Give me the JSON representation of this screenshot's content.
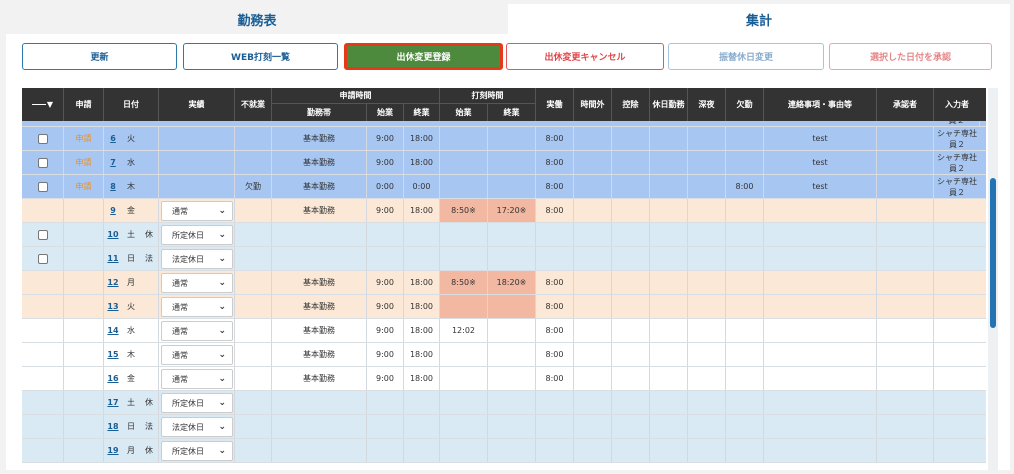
{
  "tabs": [
    {
      "label": "勤務表"
    },
    {
      "label": "集計"
    }
  ],
  "toolbar": {
    "update": "更新",
    "web_list": "WEB打刻一覧",
    "leave_change_register": "出休変更登録",
    "leave_change_cancel": "出休変更キャンセル",
    "substitute_change": "振替休日変更",
    "approve_selected": "選択した日付を承認"
  },
  "table": {
    "headers": {
      "check": "▼",
      "request": "申請",
      "date": "日付",
      "actual": "実績",
      "absence": "不就業",
      "request_time": "申請時間",
      "shift": "勤務帯",
      "start": "始業",
      "end": "終業",
      "stamp_time": "打刻時間",
      "stamp_start": "始業",
      "stamp_end": "終業",
      "worked": "実働",
      "overtime": "時間外",
      "deduction": "控除",
      "holiday_work": "休日勤務",
      "late_night": "深夜",
      "absent": "欠勤",
      "notes": "連絡事項・事由等",
      "approver": "承認者",
      "entered_by": "入力者"
    },
    "partial_top": "員２",
    "rows": [
      {
        "bg": "#a7c6f2",
        "check": true,
        "req": "申請",
        "day": "6",
        "wd": "火",
        "hol": "",
        "actual": "",
        "absence": "",
        "shift": "基本勤務",
        "start": "9:00",
        "end": "18:00",
        "s_start": "",
        "s_end": "",
        "worked": "8:00",
        "absent": "",
        "notes": "test",
        "entered_line1": "シャチ専社",
        "entered_line2": "員２"
      },
      {
        "bg": "#a7c6f2",
        "check": true,
        "req": "申請",
        "day": "7",
        "wd": "水",
        "hol": "",
        "actual": "",
        "absence": "",
        "shift": "基本勤務",
        "start": "9:00",
        "end": "18:00",
        "s_start": "",
        "s_end": "",
        "worked": "8:00",
        "absent": "",
        "notes": "test",
        "entered_line1": "シャチ専社",
        "entered_line2": "員２"
      },
      {
        "bg": "#a7c6f2",
        "check": true,
        "req": "申請",
        "day": "8",
        "wd": "木",
        "hol": "",
        "actual": "",
        "absence": "欠勤",
        "shift": "基本勤務",
        "start": "0:00",
        "end": "0:00",
        "s_start": "",
        "s_end": "",
        "worked": "8:00",
        "absent": "8:00",
        "notes": "test",
        "entered_line1": "シャチ専社",
        "entered_line2": "員２"
      },
      {
        "bg": "#fbe8d6",
        "check": false,
        "req": "",
        "day": "9",
        "wd": "金",
        "hol": "",
        "actual": "通常",
        "absence": "",
        "shift": "基本勤務",
        "start": "9:00",
        "end": "18:00",
        "s_start": "8:50※",
        "s_end": "17:20※",
        "pink": true,
        "worked": "8:00",
        "absent": "",
        "notes": "",
        "entered_line1": "",
        "entered_line2": ""
      },
      {
        "bg": "#d9eaf4",
        "check": true,
        "req": "",
        "day": "10",
        "wd": "土",
        "hol": "休",
        "actual": "所定休日",
        "absence": "",
        "shift": "",
        "start": "",
        "end": "",
        "s_start": "",
        "s_end": "",
        "worked": "",
        "absent": "",
        "notes": "",
        "entered_line1": "",
        "entered_line2": ""
      },
      {
        "bg": "#d9eaf4",
        "check": true,
        "req": "",
        "day": "11",
        "wd": "日",
        "hol": "法",
        "actual": "法定休日",
        "absence": "",
        "shift": "",
        "start": "",
        "end": "",
        "s_start": "",
        "s_end": "",
        "worked": "",
        "absent": "",
        "notes": "",
        "entered_line1": "",
        "entered_line2": ""
      },
      {
        "bg": "#fbe8d6",
        "check": false,
        "req": "",
        "day": "12",
        "wd": "月",
        "hol": "",
        "actual": "通常",
        "absence": "",
        "shift": "基本勤務",
        "start": "9:00",
        "end": "18:00",
        "s_start": "8:50※",
        "s_end": "18:20※",
        "pink": true,
        "worked": "8:00",
        "absent": "",
        "notes": "",
        "entered_line1": "",
        "entered_line2": ""
      },
      {
        "bg": "#fbe8d6",
        "check": false,
        "req": "",
        "day": "13",
        "wd": "火",
        "hol": "",
        "actual": "通常",
        "absence": "",
        "shift": "基本勤務",
        "start": "9:00",
        "end": "18:00",
        "s_start": "",
        "s_end": "",
        "pink": true,
        "worked": "8:00",
        "absent": "",
        "notes": "",
        "entered_line1": "",
        "entered_line2": ""
      },
      {
        "bg": "#ffffff",
        "check": false,
        "req": "",
        "day": "14",
        "wd": "水",
        "hol": "",
        "actual": "通常",
        "absence": "",
        "shift": "基本勤務",
        "start": "9:00",
        "end": "18:00",
        "s_start": "12:02",
        "s_end": "",
        "worked": "8:00",
        "absent": "",
        "notes": "",
        "entered_line1": "",
        "entered_line2": ""
      },
      {
        "bg": "#ffffff",
        "check": false,
        "req": "",
        "day": "15",
        "wd": "木",
        "hol": "",
        "actual": "通常",
        "absence": "",
        "shift": "基本勤務",
        "start": "9:00",
        "end": "18:00",
        "s_start": "",
        "s_end": "",
        "worked": "8:00",
        "absent": "",
        "notes": "",
        "entered_line1": "",
        "entered_line2": ""
      },
      {
        "bg": "#ffffff",
        "check": false,
        "req": "",
        "day": "16",
        "wd": "金",
        "hol": "",
        "actual": "通常",
        "absence": "",
        "shift": "基本勤務",
        "start": "9:00",
        "end": "18:00",
        "s_start": "",
        "s_end": "",
        "worked": "8:00",
        "absent": "",
        "notes": "",
        "entered_line1": "",
        "entered_line2": ""
      },
      {
        "bg": "#d9eaf4",
        "check": false,
        "req": "",
        "day": "17",
        "wd": "土",
        "hol": "休",
        "actual": "所定休日",
        "absence": "",
        "shift": "",
        "start": "",
        "end": "",
        "s_start": "",
        "s_end": "",
        "worked": "",
        "absent": "",
        "notes": "",
        "entered_line1": "",
        "entered_line2": ""
      },
      {
        "bg": "#d9eaf4",
        "check": false,
        "req": "",
        "day": "18",
        "wd": "日",
        "hol": "法",
        "actual": "法定休日",
        "absence": "",
        "shift": "",
        "start": "",
        "end": "",
        "s_start": "",
        "s_end": "",
        "worked": "",
        "absent": "",
        "notes": "",
        "entered_line1": "",
        "entered_line2": ""
      },
      {
        "bg": "#d9eaf4",
        "check": false,
        "req": "",
        "day": "19",
        "wd": "月",
        "hol": "休",
        "actual": "所定休日",
        "absence": "",
        "shift": "",
        "start": "",
        "end": "",
        "s_start": "",
        "s_end": "",
        "worked": "",
        "absent": "",
        "notes": "",
        "entered_line1": "",
        "entered_line2": ""
      }
    ]
  }
}
